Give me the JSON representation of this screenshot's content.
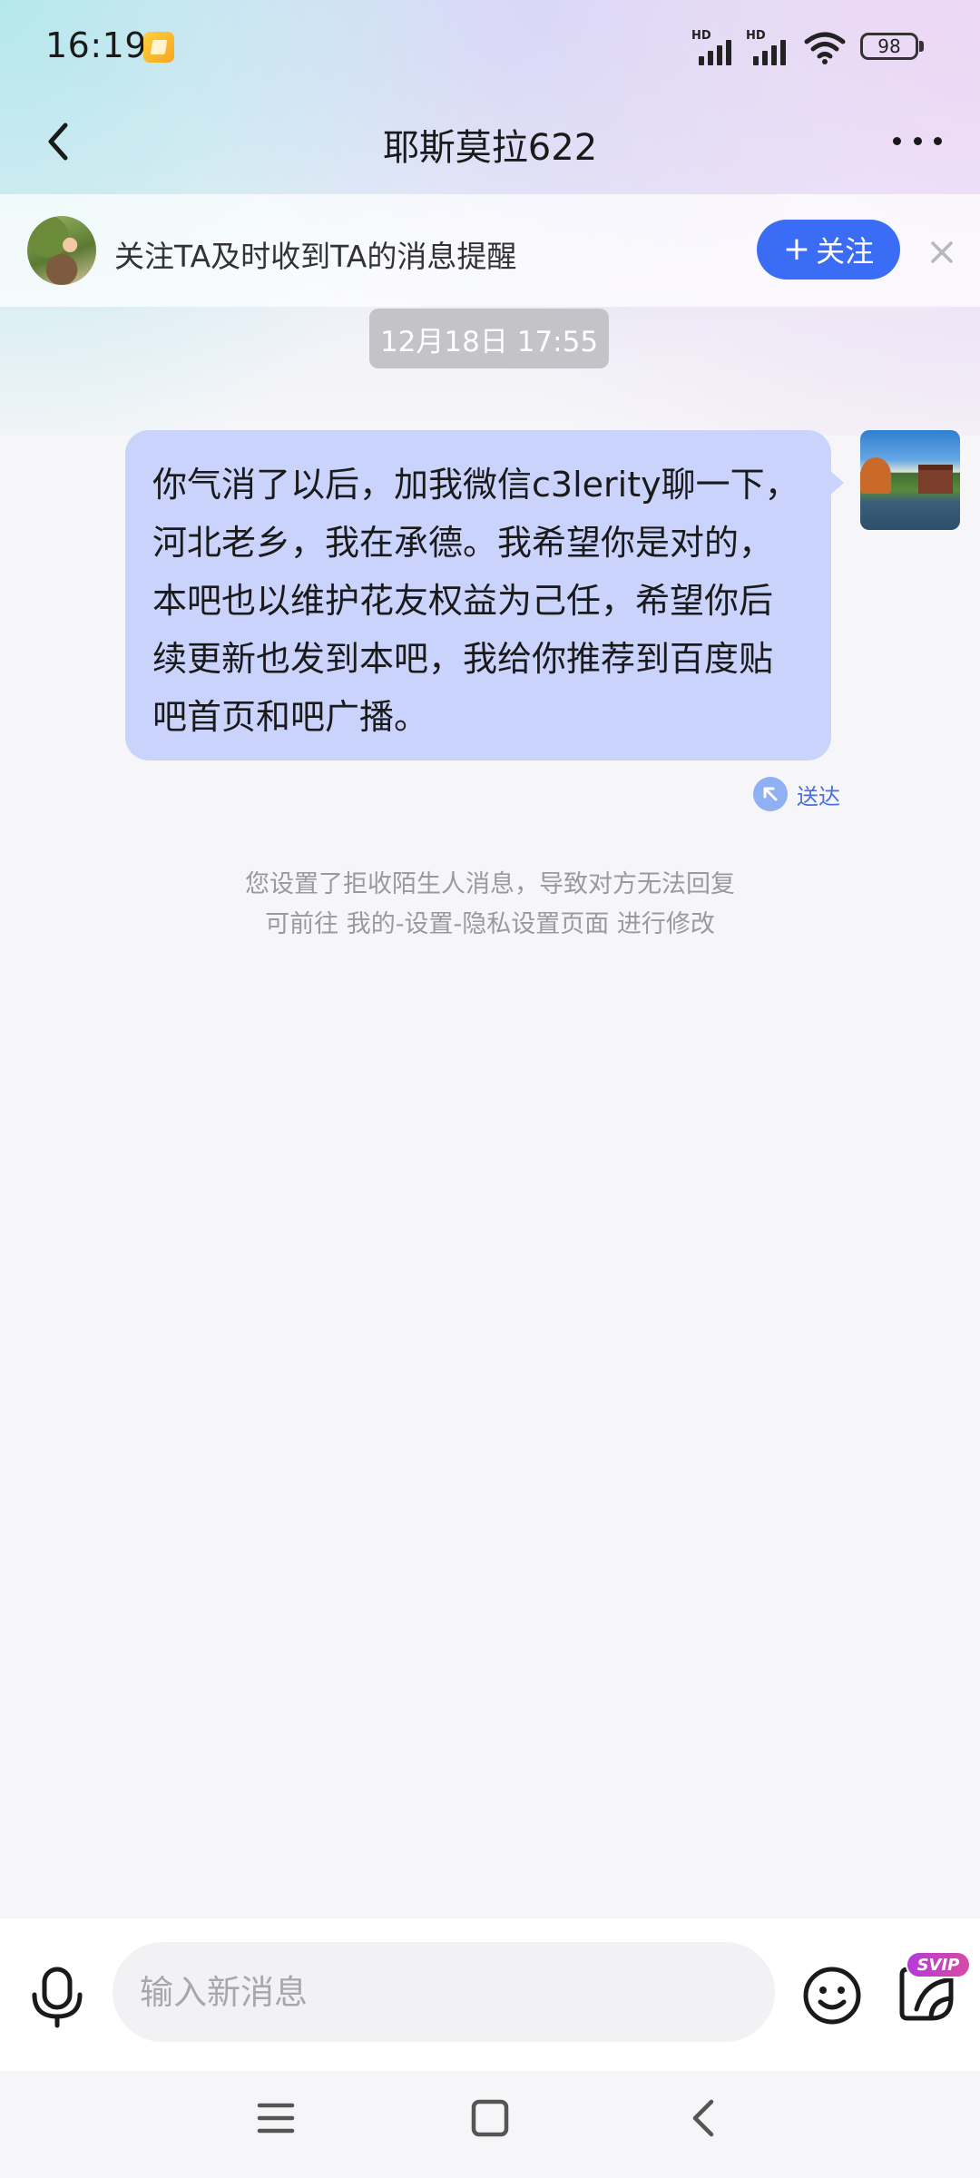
{
  "status_bar": {
    "time": "16:19",
    "signal_label": "HD",
    "signal_label_2": "HD",
    "battery": "98"
  },
  "header": {
    "title": "耶斯莫拉622",
    "back_icon": "chevron-left-icon",
    "more_icon": "more-horizontal-icon"
  },
  "follow_banner": {
    "text": "关注TA及时收到TA的消息提醒",
    "button_label": "+ 关注",
    "button_plus": "+",
    "button_text": "关注",
    "close_icon": "close-icon"
  },
  "conversation": {
    "date": "12月18日 17:55",
    "messages": [
      {
        "text": "你气消了以后，加我微信c3lerity聊一下，河北老乡，我在承德。我希望你是对的，本吧也以维护花友权益为己任，希望你后续更新也发到本吧，我给你推荐到百度贴吧首页和吧广播。",
        "status": "送达",
        "from_self": true
      }
    ],
    "notice_line1": "您设置了拒收陌生人消息，导致对方无法回复",
    "notice_line2": "可前往 我的-设置-隐私设置页面 进行修改"
  },
  "input_bar": {
    "placeholder": "输入新消息",
    "value": "",
    "svip_badge": "SVIP",
    "mic_icon": "microphone-icon",
    "emoji_icon": "emoji-icon",
    "sticker_icon": "sticker-icon"
  },
  "colors": {
    "accent": "#3b6cf6",
    "bubble": "#c9d3fb",
    "date_chip": "#c4c4c8",
    "svip": "#c23fd0"
  }
}
